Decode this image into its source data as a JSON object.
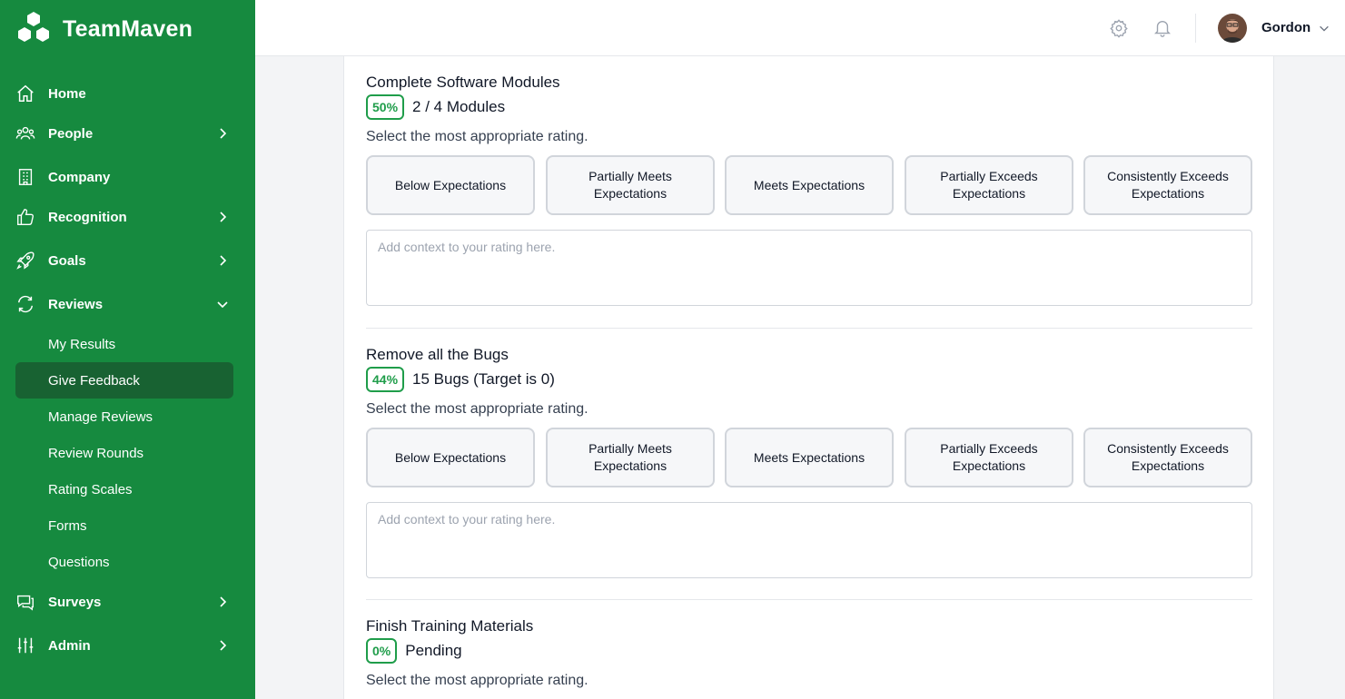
{
  "brand": {
    "name": "TeamMaven"
  },
  "nav": {
    "home": "Home",
    "people": "People",
    "company": "Company",
    "recognition": "Recognition",
    "goals": "Goals",
    "reviews": "Reviews",
    "reviews_sub": [
      "My Results",
      "Give Feedback",
      "Manage Reviews",
      "Review Rounds",
      "Rating Scales",
      "Forms",
      "Questions"
    ],
    "surveys": "Surveys",
    "admin": "Admin"
  },
  "header": {
    "user_name": "Gordon"
  },
  "common": {
    "prompt": "Select the most appropriate rating.",
    "placeholder": "Add context to your rating here.",
    "ratings": [
      "Below Expectations",
      "Partially Meets Expectations",
      "Meets Expectations",
      "Partially Exceeds Expectations",
      "Consistently Exceeds Expectations"
    ]
  },
  "goals": [
    {
      "title": "Complete Software Modules",
      "percent": "50%",
      "progress": "2 / 4 Modules"
    },
    {
      "title": "Remove all the Bugs",
      "percent": "44%",
      "progress": "15 Bugs (Target is 0)"
    },
    {
      "title": "Finish Training Materials",
      "percent": "0%",
      "progress": "Pending"
    }
  ],
  "colors": {
    "sidebar": "#168a3f",
    "active": "#186232",
    "accent": "#1f9d4a"
  }
}
